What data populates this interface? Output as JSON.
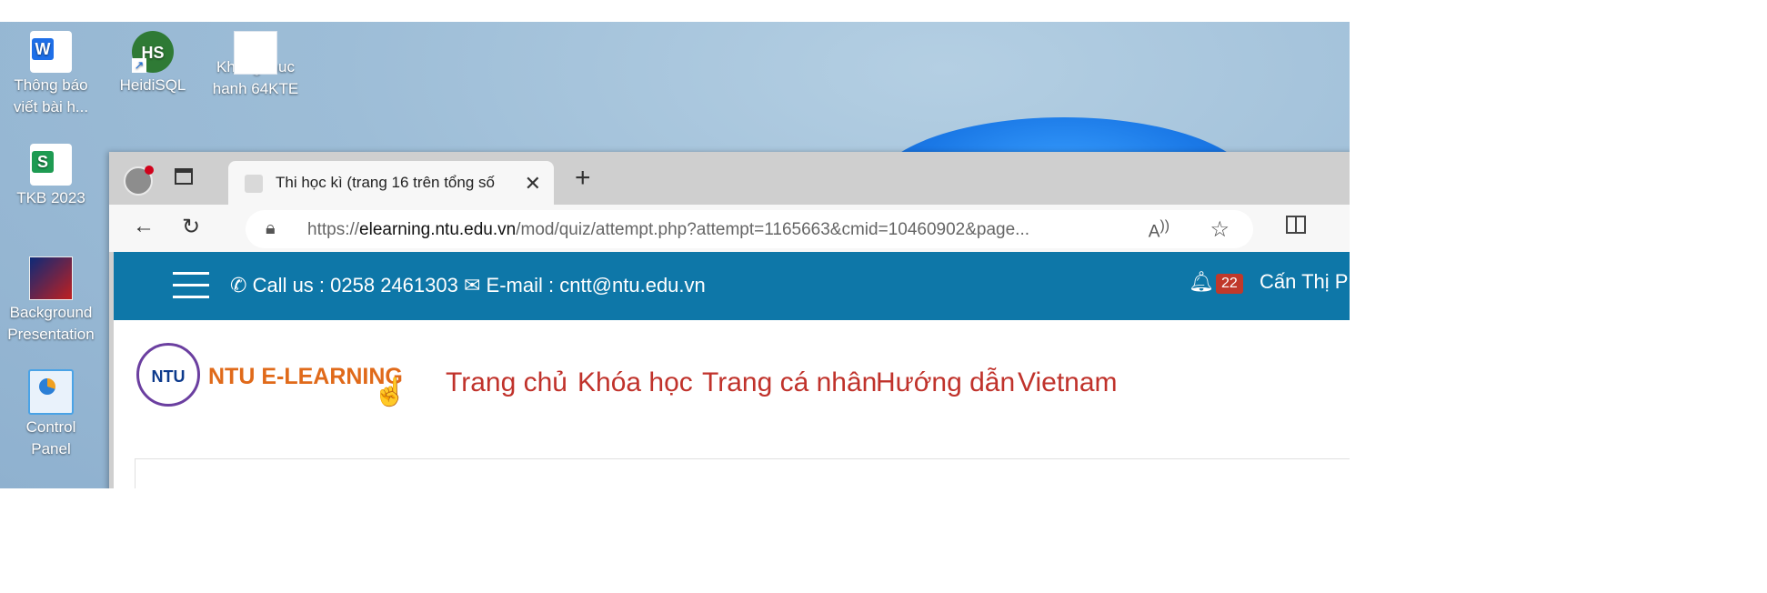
{
  "desktop": {
    "icons": [
      {
        "label": "Thông báo viết bài h...",
        "icon": "word-document-icon"
      },
      {
        "label": "HeidiSQL",
        "icon": "heidisql-shortcut-icon"
      },
      {
        "label": "Khong thuc hanh 64KTE",
        "icon": "folder-icon"
      },
      {
        "label": "TKB 2023",
        "icon": "spreadsheet-icon"
      },
      {
        "label": "Background Presentation",
        "icon": "presentation-icon"
      },
      {
        "label": "Control Panel",
        "icon": "control-panel-icon"
      }
    ]
  },
  "browser": {
    "tab_title": "Thi học kì (trang 16 trên tổng số",
    "new_tab_glyph": "+",
    "url_scheme": "https://",
    "url_host": "elearning.ntu.edu.vn",
    "url_path": "/mod/quiz/attempt.php?attempt=1165663&cmid=10460902&page..."
  },
  "site": {
    "header": {
      "call_label": "Call us : 0258 2461303",
      "email_label": "E-mail : cntt@ntu.edu.vn",
      "notification_count": "22",
      "user_name": "Cấn Thị P"
    },
    "logo": {
      "circle_text": "NTU",
      "text": "NTU E-LEARNING"
    },
    "nav": [
      "Trang chủ",
      "Khóa học",
      "Trang cá nhân",
      "Hướng dẫn",
      "Vietnam"
    ]
  },
  "colors": {
    "header_bg": "#0e77a8",
    "nav_link": "#c0322b",
    "logo_text": "#e06a1a"
  }
}
